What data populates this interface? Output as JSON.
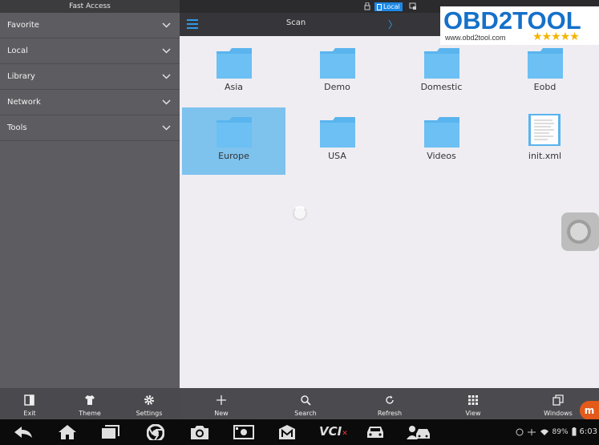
{
  "sidebar": {
    "title": "Fast Access",
    "items": [
      {
        "label": "Favorite"
      },
      {
        "label": "Local"
      },
      {
        "label": "Library"
      },
      {
        "label": "Network"
      },
      {
        "label": "Tools"
      }
    ]
  },
  "status": {
    "location_chip": "Local"
  },
  "header": {
    "title": "Scan"
  },
  "logo": {
    "brand": "OBD2TOOL",
    "url": "www.obd2tool.com",
    "stars": "★★★★★"
  },
  "files": [
    {
      "name": "Asia",
      "type": "folder",
      "selected": false
    },
    {
      "name": "Demo",
      "type": "folder",
      "selected": false
    },
    {
      "name": "Domestic",
      "type": "folder",
      "selected": false
    },
    {
      "name": "Eobd",
      "type": "folder",
      "selected": false
    },
    {
      "name": "Europe",
      "type": "folder",
      "selected": true
    },
    {
      "name": "USA",
      "type": "folder",
      "selected": false
    },
    {
      "name": "Videos",
      "type": "folder",
      "selected": false
    },
    {
      "name": "init.xml",
      "type": "file",
      "selected": false
    }
  ],
  "toolbar_left": {
    "exit": "Exit",
    "theme": "Theme",
    "settings": "Settings"
  },
  "toolbar_right": {
    "new": "New",
    "search": "Search",
    "refresh": "Refresh",
    "view": "View",
    "windows": "Windows"
  },
  "system": {
    "battery": "89%",
    "time": "6:03",
    "vci_label": "VCI"
  },
  "colors": {
    "accent": "#2d9be8",
    "selection": "#7ec2ee",
    "folder": "#5ab4ee"
  }
}
